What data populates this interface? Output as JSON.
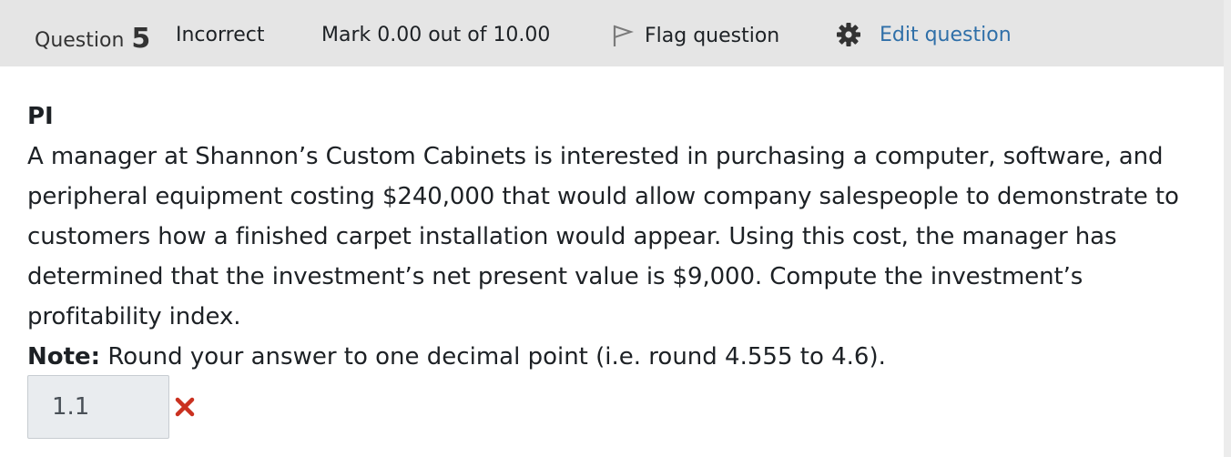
{
  "question_info": {
    "label": "Question",
    "number": "5",
    "state": "Incorrect",
    "grade": "Mark 0.00 out of 10.00",
    "flag_label": "Flag question",
    "edit_label": "Edit question"
  },
  "question": {
    "title": "PI",
    "text": "A manager at Shannon’s Custom Cabinets is interested in purchasing a computer, software, and peripheral equipment costing $240,000 that would allow company salespeople to demonstrate to customers how a finished carpet installation would appear. Using this cost, the manager has determined that the investment’s net present value is $9,000. Compute the investment’s profitability index.",
    "note_label": "Note:",
    "note_text": " Round your answer to one decimal point (i.e. round 4.555 to 4.6)."
  },
  "answer": {
    "value": "1.1",
    "status_icon": "incorrect-x-icon"
  },
  "colors": {
    "header_bg": "#e5e5e5",
    "link": "#2f6fa8",
    "incorrect": "#ca3120",
    "input_bg": "#e9ecef"
  }
}
